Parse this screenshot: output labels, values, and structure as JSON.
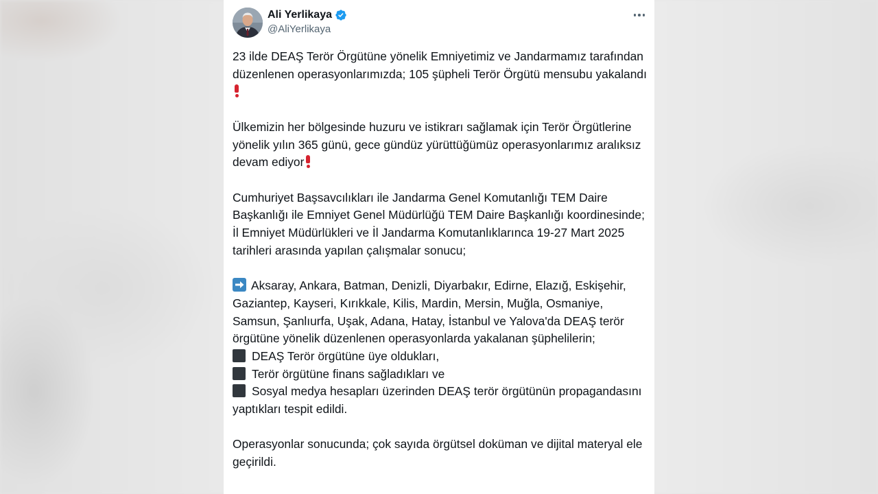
{
  "author": {
    "display_name": "Ali Yerlikaya",
    "handle": "@AliYerlikaya"
  },
  "icons": {
    "verified": "verified-badge-icon",
    "more": "more-options-icon",
    "exclaim": "red-exclamation-emoji",
    "arrow": "right-arrow-emoji",
    "square": "black-square-emoji"
  },
  "colors": {
    "verified_blue": "#1d9bf0",
    "text": "#0f1419",
    "secondary": "#536471"
  },
  "tweet": {
    "p1": "23 ilde DEAŞ Terör Örgütüne yönelik Emniyetimiz ve Jandarmamız tarafından düzenlenen operasyonlarımızda; 105 şüpheli Terör Örgütü mensubu yakalandı",
    "p2": "Ülkemizin her bölgesinde huzuru ve istikrarı sağlamak için Terör Örgütlerine yönelik yılın 365 günü, gece gündüz yürüttüğümüz operasyonlarımız aralıksız devam ediyor",
    "p3": "Cumhuriyet Başsavcılıkları ile Jandarma Genel Komutanlığı TEM Daire Başkanlığı ile Emniyet Genel Müdürlüğü TEM Daire Başkanlığı koordinesinde; İl Emniyet Müdürlükleri ve İl Jandarma Komutanlıklarınca 19-27 Mart 2025 tarihleri arasında yapılan çalışmalar sonucu;",
    "p4": "Aksaray, Ankara, Batman, Denizli, Diyarbakır, Edirne, Elazığ, Eskişehir, Gaziantep, Kayseri, Kırıkkale, Kilis, Mardin, Mersin, Muğla, Osmaniye, Samsun, Şanlıurfa, Uşak, Adana, Hatay, İstanbul ve Yalova'da  DEAŞ terör örgütüne yönelik düzenlenen operasyonlarda yakalanan şüphelilerin;",
    "bullets": [
      "DEAŞ Terör örgütüne üye oldukları,",
      "Terör örgütüne finans sağladıkları ve",
      "Sosyal medya hesapları üzerinden DEAŞ terör örgütünün propagandasını yaptıkları tespit edildi."
    ],
    "p5": "Operasyonlar sonucunda; çok sayıda örgütsel doküman ve dijital materyal ele geçirildi."
  }
}
